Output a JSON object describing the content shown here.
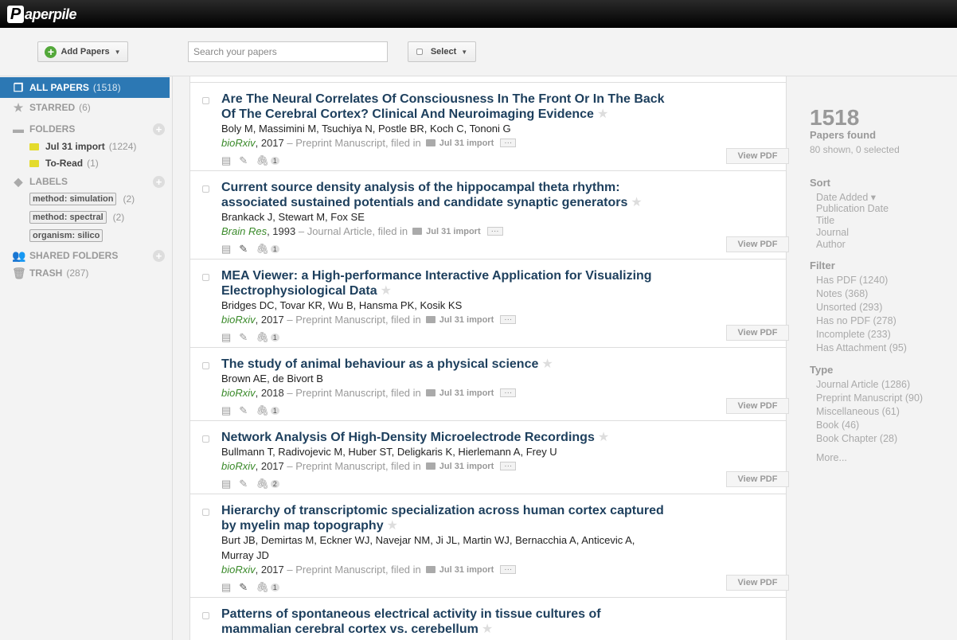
{
  "app": {
    "logo_letter": "P",
    "logo_text": "aperpile"
  },
  "toolbar": {
    "add_label": "Add Papers",
    "search_placeholder": "Search your papers",
    "select_label": "Select"
  },
  "sidebar": {
    "all_papers": {
      "label": "ALL PAPERS",
      "count": "(1518)"
    },
    "starred": {
      "label": "STARRED",
      "count": "(6)"
    },
    "folders": {
      "label": "FOLDERS",
      "items": [
        {
          "label": "Jul 31 import",
          "count": "(1224)"
        },
        {
          "label": "To-Read",
          "count": "(1)"
        }
      ]
    },
    "labels": {
      "label": "LABELS",
      "items": [
        {
          "label": "method: simulation",
          "count": "(2)"
        },
        {
          "label": "method: spectral",
          "count": "(2)"
        },
        {
          "label": "organism: silico",
          "count": ""
        }
      ]
    },
    "shared": {
      "label": "SHARED FOLDERS"
    },
    "trash": {
      "label": "TRASH",
      "count": "(287)"
    }
  },
  "papers": [
    {
      "title": "Are The Neural Correlates Of Consciousness In The Front Or In The Back Of The Cerebral Cortex? Clinical And Neuroimaging Evidence",
      "authors": "Boly M, Massimini M, Tsuchiya N, Postle BR, Koch C, Tononi G",
      "journal": "bioRxiv",
      "year": ", 2017",
      "type": "– Preprint Manuscript, filed in",
      "folder": "Jul 31 import",
      "attachments": "1"
    },
    {
      "title": "Current source density analysis of the hippocampal theta rhythm: associated sustained potentials and candidate synaptic generators",
      "authors": "Brankack J, Stewart M, Fox SE",
      "journal": "Brain Res",
      "year": ", 1993",
      "type": "– Journal Article, filed in",
      "folder": "Jul 31 import",
      "attachments": "1"
    },
    {
      "title": "MEA Viewer: a High-performance Interactive Application for Visualizing Electrophysiological Data",
      "authors": "Bridges DC, Tovar KR, Wu B, Hansma PK, Kosik KS",
      "journal": "bioRxiv",
      "year": ", 2017",
      "type": "– Preprint Manuscript, filed in",
      "folder": "Jul 31 import",
      "attachments": "1"
    },
    {
      "title": "The study of animal behaviour as a physical science",
      "authors": "Brown AE, de Bivort B",
      "journal": "bioRxiv",
      "year": ", 2018",
      "type": "– Preprint Manuscript, filed in",
      "folder": "Jul 31 import",
      "attachments": "1"
    },
    {
      "title": "Network Analysis Of High-Density Microelectrode Recordings",
      "authors": "Bullmann T, Radivojevic M, Huber ST, Deligkaris K, Hierlemann A, Frey U",
      "journal": "bioRxiv",
      "year": ", 2017",
      "type": "– Preprint Manuscript, filed in",
      "folder": "Jul 31 import",
      "attachments": "2"
    },
    {
      "title": "Hierarchy of transcriptomic specialization across human cortex captured by myelin map topography",
      "authors": "Burt JB, Demirtas M, Eckner WJ, Navejar NM, Ji JL, Martin WJ, Bernacchia A, Anticevic A, Murray JD",
      "journal": "bioRxiv",
      "year": ", 2017",
      "type": "– Preprint Manuscript, filed in",
      "folder": "Jul 31 import",
      "attachments": "1"
    },
    {
      "title": "Patterns of spontaneous electrical activity in tissue cultures of mammalian cerebral cortex vs. cerebellum",
      "authors": "",
      "journal": "",
      "year": "",
      "type": "",
      "folder": "",
      "attachments": ""
    }
  ],
  "view_pdf_label": "View PDF",
  "more_label": "···",
  "summary": {
    "total": "1518",
    "found": "Papers found",
    "shown": "80 shown, 0 selected"
  },
  "sort": {
    "heading": "Sort",
    "items": [
      "Date Added ▾",
      "Publication Date",
      "Title",
      "Journal",
      "Author"
    ]
  },
  "filter": {
    "heading": "Filter",
    "items": [
      "Has PDF (1240)",
      "Notes (368)",
      "Unsorted (293)",
      "Has no PDF (278)",
      "Incomplete (233)",
      "Has Attachment (95)"
    ]
  },
  "type": {
    "heading": "Type",
    "items": [
      "Journal Article (1286)",
      "Preprint Manuscript (90)",
      "Miscellaneous (61)",
      "Book (46)",
      "Book Chapter (28)"
    ],
    "more": "More..."
  },
  "colors": {
    "accent": "#2c78b4",
    "title": "#1d3f5d",
    "journal": "#3a8a2a",
    "folder": "#e4db2c"
  }
}
